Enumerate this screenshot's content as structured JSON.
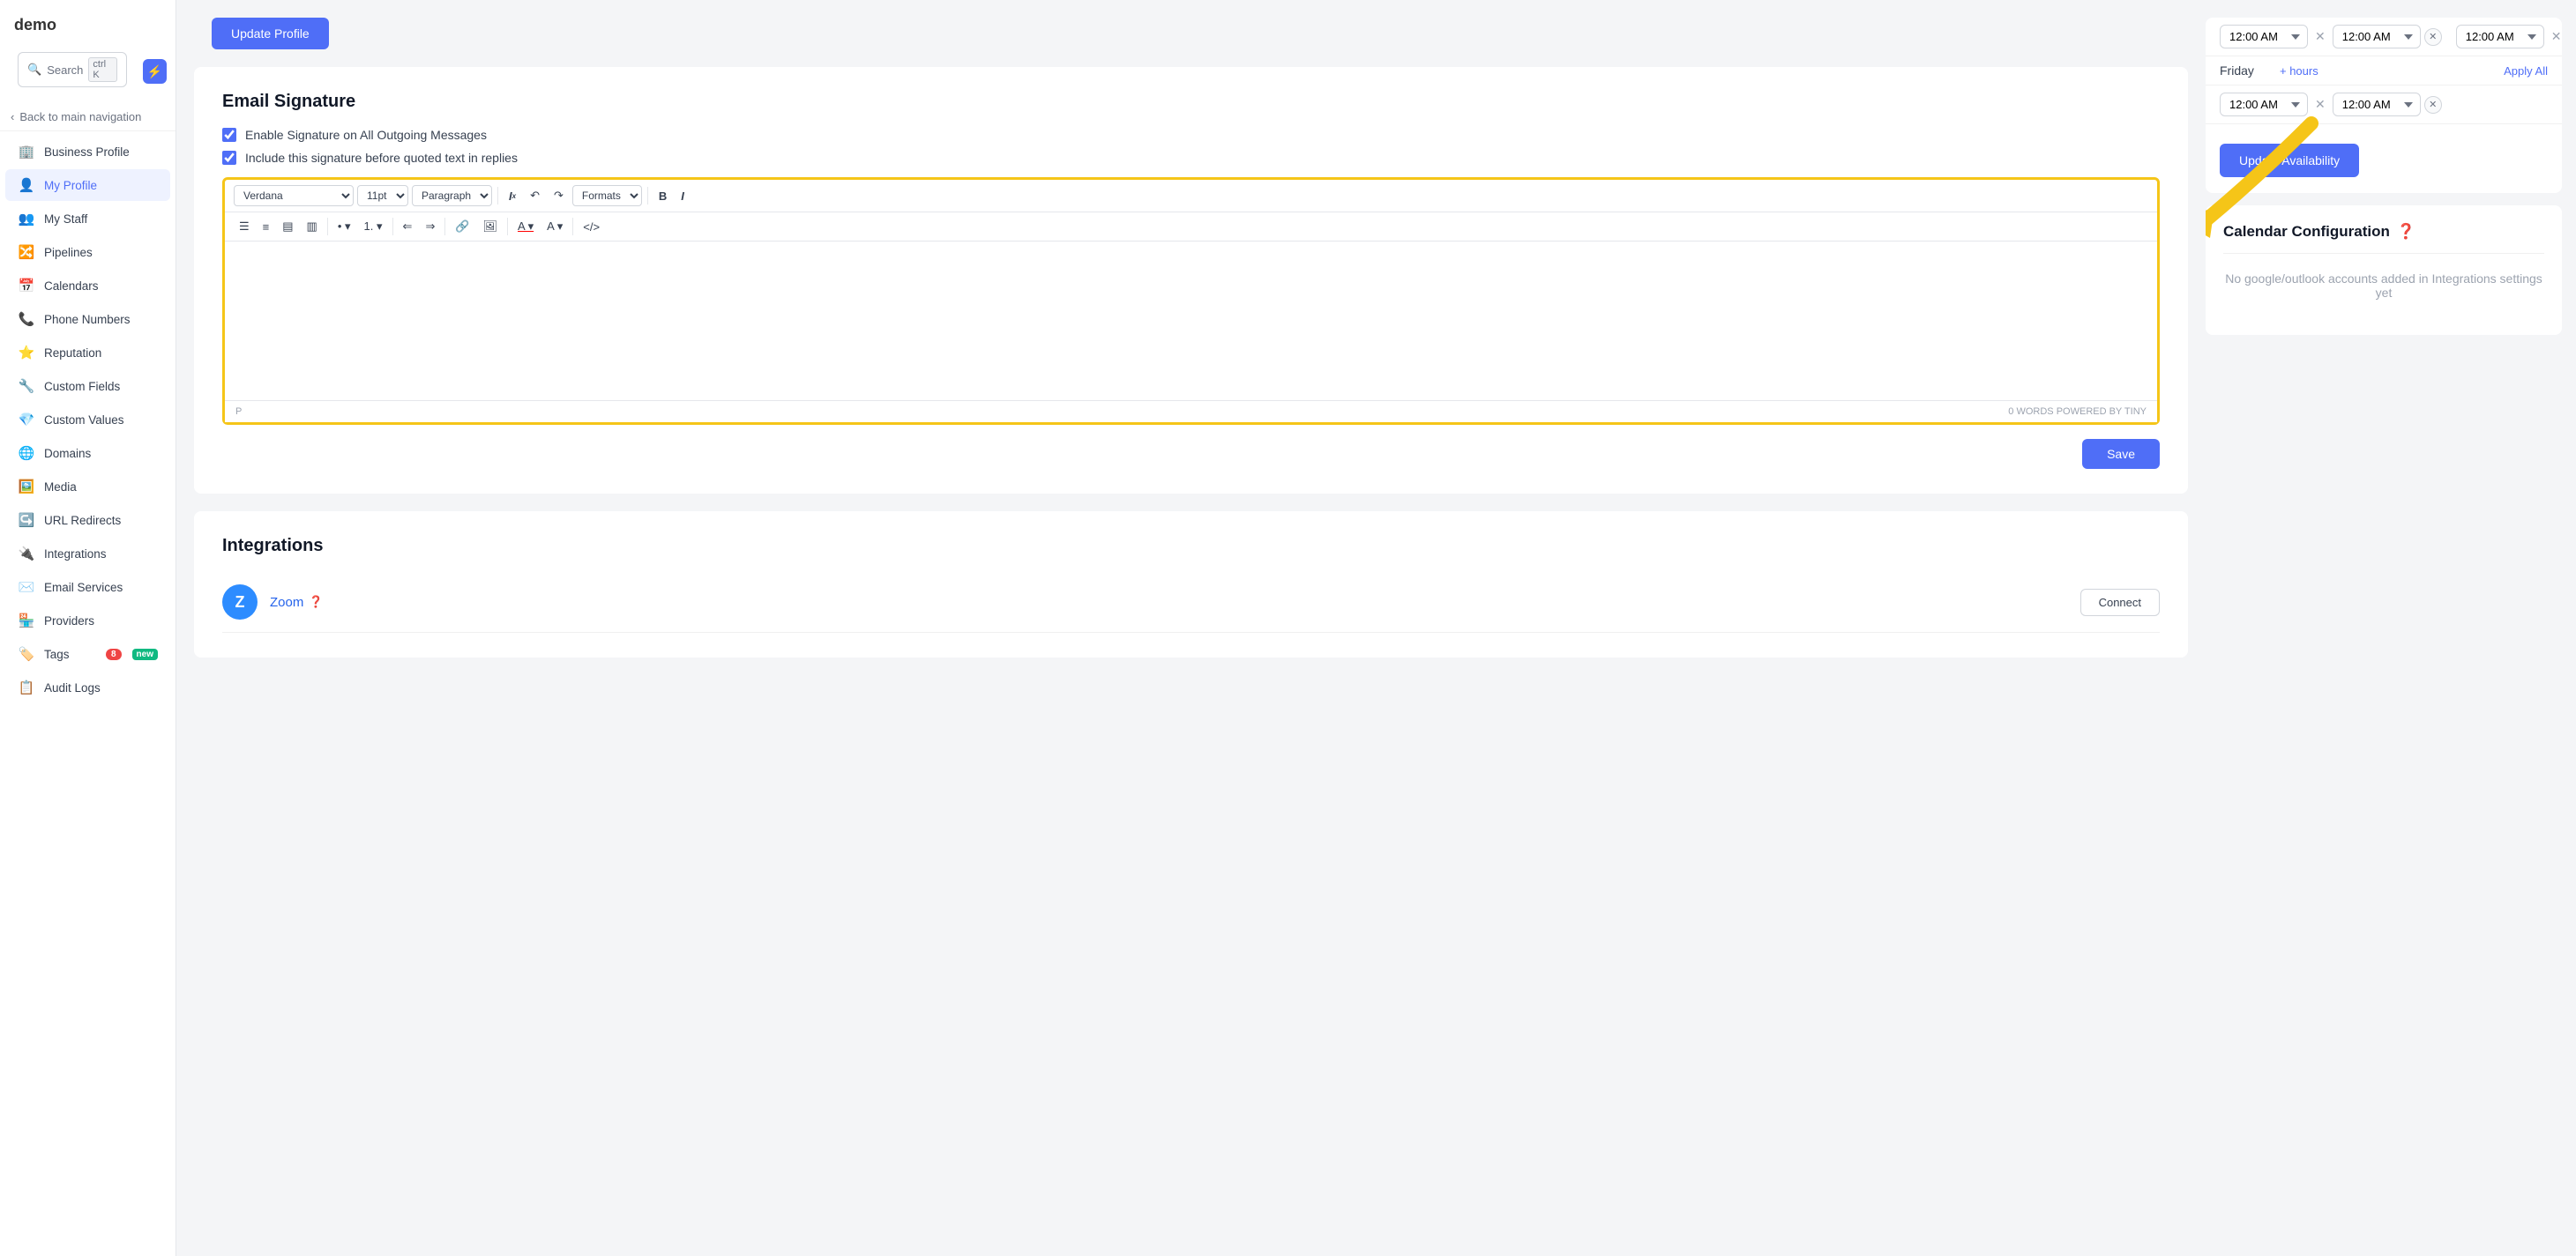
{
  "app": {
    "logo": "demo",
    "search_label": "Search",
    "search_shortcut": "ctrl K",
    "flash_icon": "⚡"
  },
  "sidebar": {
    "back_label": "Back to main navigation",
    "items": [
      {
        "id": "business-profile",
        "label": "Business Profile",
        "icon": "🏢",
        "active": false
      },
      {
        "id": "my-profile",
        "label": "My Profile",
        "icon": "👤",
        "active": true
      },
      {
        "id": "my-staff",
        "label": "My Staff",
        "icon": "👥",
        "active": false
      },
      {
        "id": "pipelines",
        "label": "Pipelines",
        "icon": "🔀",
        "active": false
      },
      {
        "id": "calendars",
        "label": "Calendars",
        "icon": "📅",
        "active": false
      },
      {
        "id": "phone-numbers",
        "label": "Phone Numbers",
        "icon": "📞",
        "active": false
      },
      {
        "id": "reputation",
        "label": "Reputation",
        "icon": "⭐",
        "active": false
      },
      {
        "id": "custom-fields",
        "label": "Custom Fields",
        "icon": "🔧",
        "active": false
      },
      {
        "id": "custom-values",
        "label": "Custom Values",
        "icon": "💎",
        "active": false
      },
      {
        "id": "domains",
        "label": "Domains",
        "icon": "🌐",
        "active": false
      },
      {
        "id": "media",
        "label": "Media",
        "icon": "🖼️",
        "active": false
      },
      {
        "id": "url-redirects",
        "label": "URL Redirects",
        "icon": "↪️",
        "active": false
      },
      {
        "id": "integrations",
        "label": "Integrations",
        "icon": "🔌",
        "active": false
      },
      {
        "id": "email-services",
        "label": "Email Services",
        "icon": "✉️",
        "active": false
      },
      {
        "id": "providers",
        "label": "Providers",
        "icon": "🏪",
        "active": false
      },
      {
        "id": "tags",
        "label": "Tags",
        "icon": "🏷️",
        "active": false,
        "badge": "8",
        "badge_new": "new"
      },
      {
        "id": "audit-logs",
        "label": "Audit Logs",
        "icon": "📋",
        "active": false
      }
    ]
  },
  "center": {
    "update_profile_btn": "Update Profile",
    "email_signature": {
      "title": "Email Signature",
      "checkbox1_label": "Enable Signature on All Outgoing Messages",
      "checkbox2_label": "Include this signature before quoted text in replies",
      "editor": {
        "font": "Verdana",
        "font_size": "11pt",
        "paragraph": "Paragraph",
        "formats_label": "Formats",
        "word_count": "0 WORDS",
        "powered_by": "POWERED BY TINY",
        "paragraph_char": "P"
      }
    },
    "save_btn": "Save",
    "integrations": {
      "title": "Integrations",
      "items": [
        {
          "id": "zoom",
          "name": "Zoom",
          "logo": "Z",
          "logo_bg": "#2d8cff",
          "connect_btn": "Connect",
          "help": true
        }
      ]
    }
  },
  "right": {
    "availability": {
      "friday_label": "Friday",
      "plus_hours": "+ hours",
      "apply_all": "Apply All",
      "times": [
        {
          "start": "12:00 AM",
          "end": "12:00 AM"
        },
        {
          "start": "12:00 AM",
          "end": "12:00 AM"
        },
        {
          "start": "12:00 AM",
          "end": "12:00 AM"
        }
      ],
      "update_btn": "Update Availability"
    },
    "calendar_config": {
      "title": "Calendar Configuration",
      "empty_message": "No google/outlook accounts added in Integrations settings yet"
    }
  }
}
